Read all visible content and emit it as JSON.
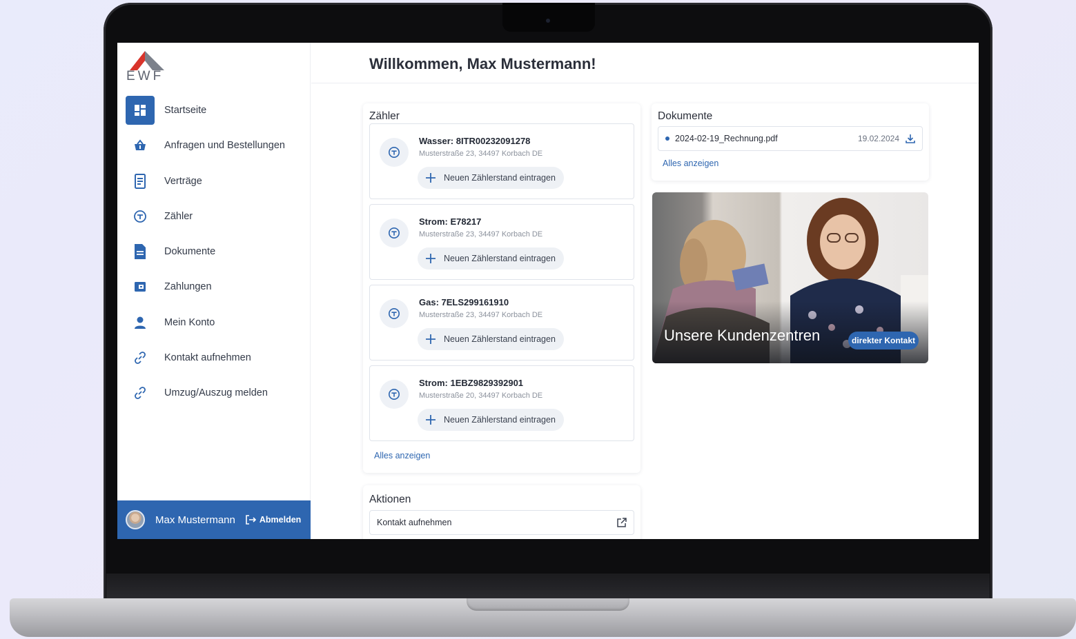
{
  "brand": {
    "logo_text": "EWF",
    "accent": "#2e66b0",
    "logo_red": "#d9342b"
  },
  "page": {
    "title": "Willkommen, Max Mustermann!"
  },
  "sidebar": {
    "items": [
      {
        "label": "Startseite",
        "icon": "dashboard-icon",
        "active": true
      },
      {
        "label": "Anfragen und Bestellungen",
        "icon": "basket-icon"
      },
      {
        "label": "Verträge",
        "icon": "contract-icon"
      },
      {
        "label": "Zähler",
        "icon": "meter-icon"
      },
      {
        "label": "Dokumente",
        "icon": "document-icon"
      },
      {
        "label": "Zahlungen",
        "icon": "wallet-icon"
      },
      {
        "label": "Mein Konto",
        "icon": "person-icon"
      },
      {
        "label": "Kontakt aufnehmen",
        "icon": "link-icon"
      },
      {
        "label": "Umzug/Auszug melden",
        "icon": "link-icon"
      }
    ]
  },
  "user": {
    "name": "Max Mustermann",
    "logout_label": "Abmelden"
  },
  "meters": {
    "title": "Zähler",
    "items": [
      {
        "title": "Wasser: 8ITR00232091278",
        "address": "Musterstraße 23, 34497 Korbach DE",
        "button": "Neuen Zählerstand eintragen"
      },
      {
        "title": "Strom: E78217",
        "address": "Musterstraße 23, 34497 Korbach DE",
        "button": "Neuen Zählerstand eintragen"
      },
      {
        "title": "Gas: 7ELS299161910",
        "address": "Musterstraße 23, 34497 Korbach DE",
        "button": "Neuen Zählerstand eintragen"
      },
      {
        "title": "Strom: 1EBZ9829392901",
        "address": "Musterstraße 20, 34497 Korbach DE",
        "button": "Neuen Zählerstand eintragen"
      }
    ],
    "show_all": "Alles anzeigen"
  },
  "documents": {
    "title": "Dokumente",
    "items": [
      {
        "name": "2024-02-19_Rechnung.pdf",
        "date": "19.02.2024"
      }
    ],
    "show_all": "Alles anzeigen"
  },
  "promo": {
    "title": "Unsere Kundenzentren",
    "button": "direkter Kontakt"
  },
  "actions": {
    "title": "Aktionen",
    "items": [
      {
        "label": "Kontakt aufnehmen",
        "icon": "external-link-icon"
      }
    ]
  }
}
